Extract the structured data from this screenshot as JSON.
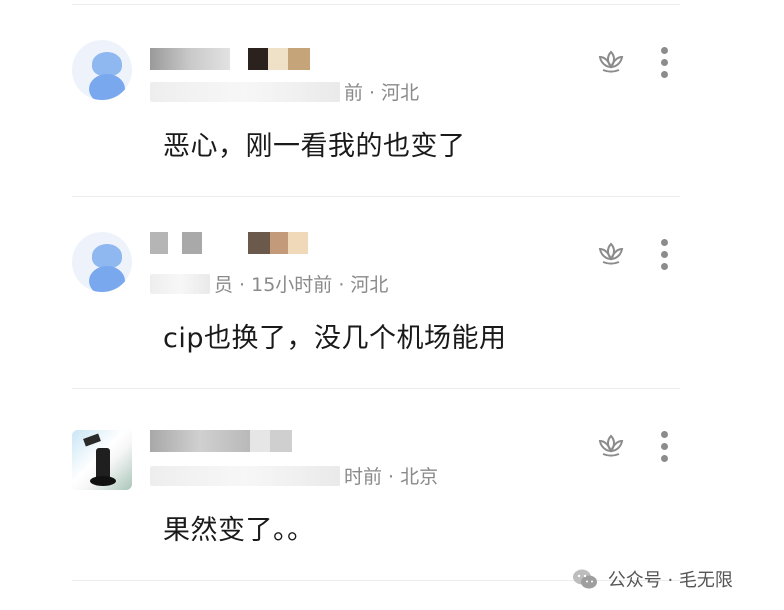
{
  "comments": [
    {
      "meta_tail": "前 · 河北",
      "text": "恶心，刚一看我的也变了",
      "avatar": "default-avatar-icon"
    },
    {
      "meta_tail": "员 · 15小时前 · 河北",
      "text": "cip也换了，没几个机场能用",
      "avatar": "default-avatar-icon"
    },
    {
      "meta_tail": "时前 · 北京",
      "text": "果然变了。。",
      "avatar": "photo-avatar"
    }
  ],
  "watermark": {
    "text": "公众号 · 毛无限",
    "icon": "wechat-icon"
  },
  "icons": {
    "like": "lotus-like-icon",
    "more": "more-vertical-icon"
  },
  "colors": {
    "text": "#1a1a1a",
    "meta": "#8a8a8a",
    "divider": "#ececec",
    "avatar_blue": "#7aa8ee"
  }
}
